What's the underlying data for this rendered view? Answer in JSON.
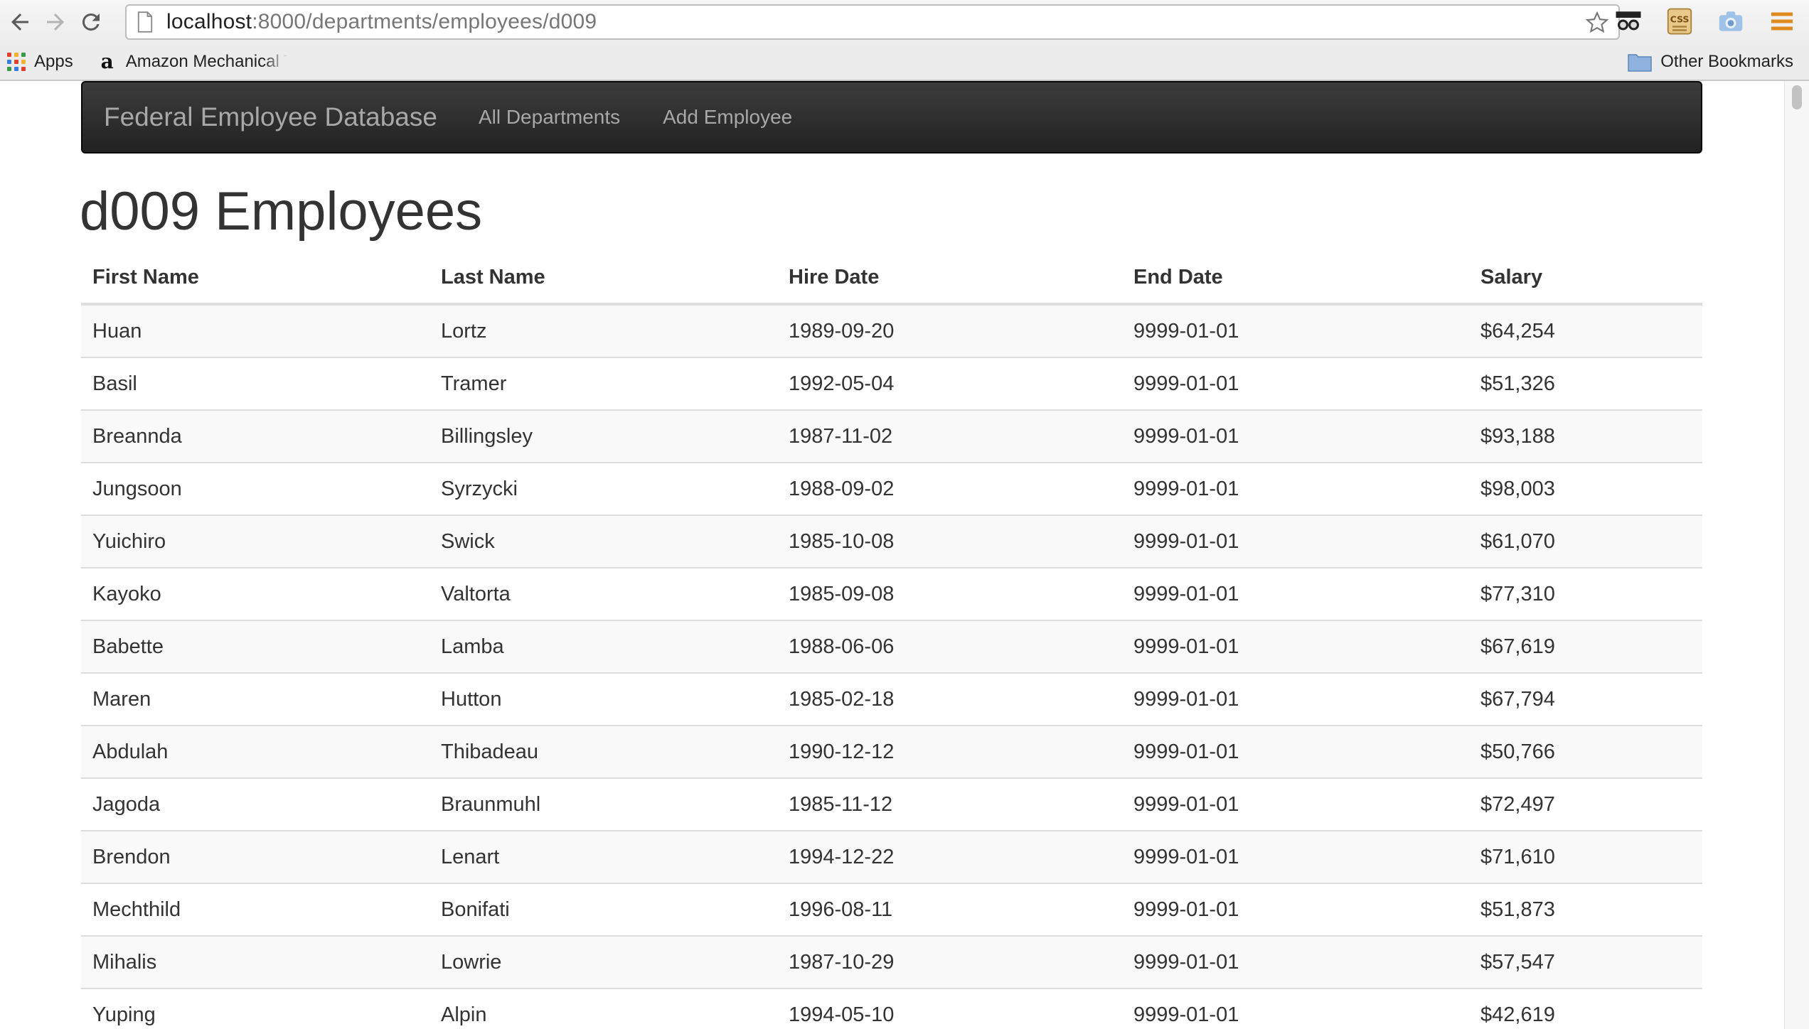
{
  "browser": {
    "url_host": "localhost",
    "url_path": ":8000/departments/employees/d009",
    "bookmarks": [
      {
        "label": "Apps",
        "icon": "apps-grid-icon"
      },
      {
        "label": "Amazon Mechanical T",
        "icon": "amazon-icon"
      }
    ],
    "other_bookmarks": "Other Bookmarks"
  },
  "navbar": {
    "brand": "Federal Employee Database",
    "links": [
      "All Departments",
      "Add Employee"
    ]
  },
  "page": {
    "title": "d009 Employees"
  },
  "table": {
    "headers": [
      "First Name",
      "Last Name",
      "Hire Date",
      "End Date",
      "Salary"
    ],
    "rows": [
      [
        "Huan",
        "Lortz",
        "1989-09-20",
        "9999-01-01",
        "$64,254"
      ],
      [
        "Basil",
        "Tramer",
        "1992-05-04",
        "9999-01-01",
        "$51,326"
      ],
      [
        "Breannda",
        "Billingsley",
        "1987-11-02",
        "9999-01-01",
        "$93,188"
      ],
      [
        "Jungsoon",
        "Syrzycki",
        "1988-09-02",
        "9999-01-01",
        "$98,003"
      ],
      [
        "Yuichiro",
        "Swick",
        "1985-10-08",
        "9999-01-01",
        "$61,070"
      ],
      [
        "Kayoko",
        "Valtorta",
        "1985-09-08",
        "9999-01-01",
        "$77,310"
      ],
      [
        "Babette",
        "Lamba",
        "1988-06-06",
        "9999-01-01",
        "$67,619"
      ],
      [
        "Maren",
        "Hutton",
        "1985-02-18",
        "9999-01-01",
        "$67,794"
      ],
      [
        "Abdulah",
        "Thibadeau",
        "1990-12-12",
        "9999-01-01",
        "$50,766"
      ],
      [
        "Jagoda",
        "Braunmuhl",
        "1985-11-12",
        "9999-01-01",
        "$72,497"
      ],
      [
        "Brendon",
        "Lenart",
        "1994-12-22",
        "9999-01-01",
        "$71,610"
      ],
      [
        "Mechthild",
        "Bonifati",
        "1996-08-11",
        "9999-01-01",
        "$51,873"
      ],
      [
        "Mihalis",
        "Lowrie",
        "1987-10-29",
        "9999-01-01",
        "$57,547"
      ],
      [
        "Yuping",
        "Alpin",
        "1994-05-10",
        "9999-01-01",
        "$42,619"
      ]
    ]
  }
}
